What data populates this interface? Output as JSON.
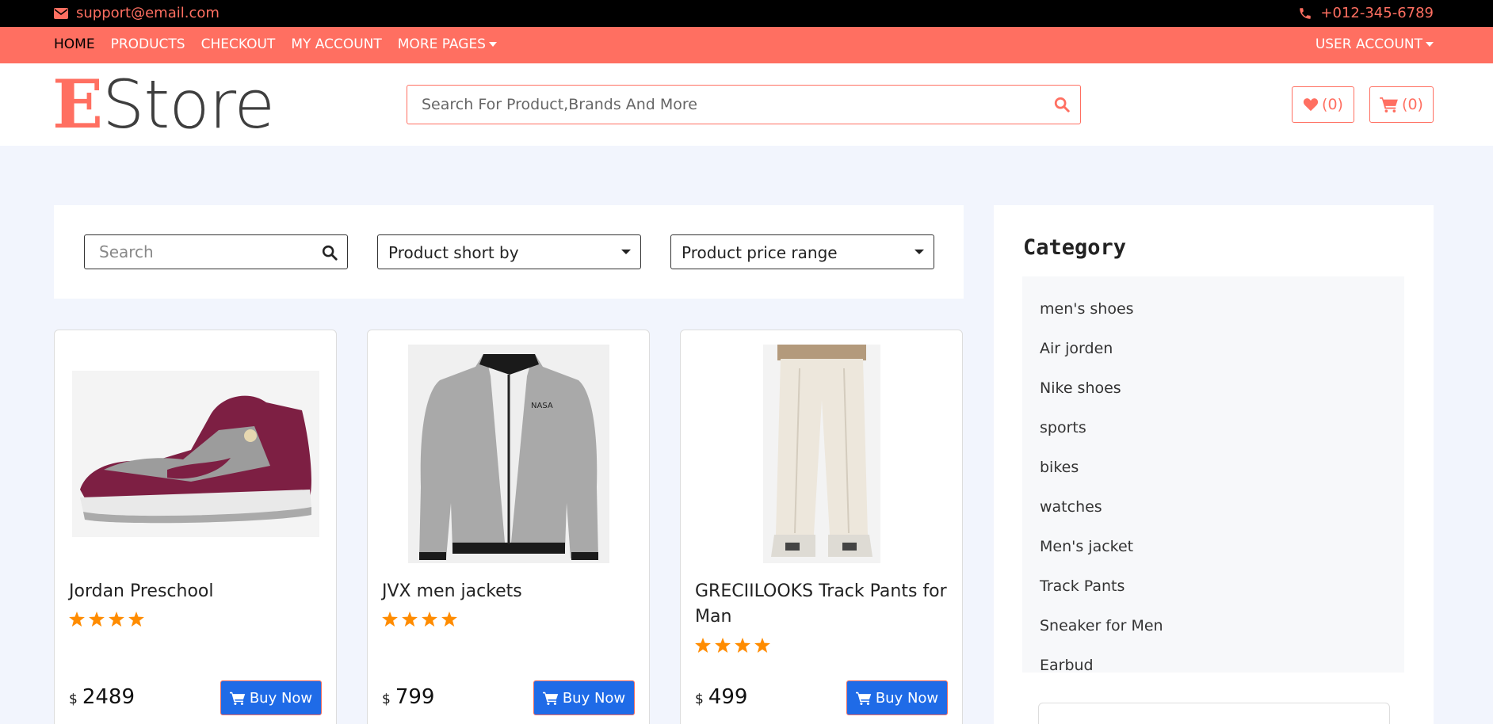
{
  "topbar": {
    "email": "support@email.com",
    "phone": "+012-345-6789"
  },
  "nav": {
    "home": "HOME",
    "products": "PRODUCTS",
    "checkout": "CHECKOUT",
    "my_account": "MY ACCOUNT",
    "more_pages": "MORE PAGES",
    "user_account": "USER ACCOUNT"
  },
  "header": {
    "logo_first": "E",
    "logo_rest": "Store",
    "search_placeholder": "Search For Product,Brands And More",
    "wishlist_count": "(0)",
    "cart_count": "(0)"
  },
  "filters": {
    "search_placeholder": "Search",
    "sort_label": "Product short by",
    "price_label": "Product price range"
  },
  "products": [
    {
      "title": "Jordan Preschool",
      "rating": 4,
      "currency": "$",
      "price": "2489",
      "buy_label": "Buy Now"
    },
    {
      "title": "JVX men jackets",
      "rating": 4,
      "currency": "$",
      "price": "799",
      "buy_label": "Buy Now"
    },
    {
      "title": "GRECIILOOKS Track Pants for Man",
      "rating": 4,
      "currency": "$",
      "price": "499",
      "buy_label": "Buy Now"
    }
  ],
  "sidebar": {
    "heading": "Category",
    "categories": [
      "men's shoes",
      "Air jorden",
      "Nike shoes",
      "sports",
      "bikes",
      "watches",
      "Men's jacket",
      "Track Pants",
      "Sneaker for Men",
      "Earbud"
    ]
  },
  "icons": {
    "email": "envelope-icon",
    "phone": "phone-icon",
    "search": "search-icon",
    "wishlist": "heart-icon",
    "cart": "cart-icon",
    "star": "star-icon"
  },
  "colors": {
    "accent": "#ff6f61",
    "buy_button": "#1f6be7",
    "star": "#ff8c00",
    "background": "#f2f5fd"
  }
}
